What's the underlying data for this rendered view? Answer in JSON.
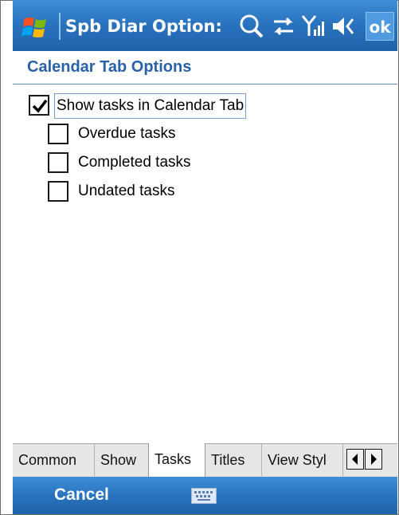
{
  "title_bar": {
    "title": "Spb Diar Option:",
    "ok_label": "ok",
    "icons": [
      "windows-start-icon",
      "search-icon",
      "connectivity-icon",
      "signal-icon",
      "volume-icon"
    ]
  },
  "page": {
    "title": "Calendar Tab Options"
  },
  "options": [
    {
      "label": "Show tasks in Calendar Tab",
      "checked": true
    },
    {
      "label": "Overdue tasks",
      "checked": false
    },
    {
      "label": "Completed tasks",
      "checked": false
    },
    {
      "label": "Undated tasks",
      "checked": false
    }
  ],
  "tabs": [
    {
      "label": "Common",
      "active": false
    },
    {
      "label": "Show",
      "active": false
    },
    {
      "label": "Tasks",
      "active": true
    },
    {
      "label": "Titles",
      "active": false
    },
    {
      "label": "View Styl",
      "active": false
    }
  ],
  "soft_keys": {
    "left": "Cancel",
    "center_icon": "keyboard-icon"
  },
  "colors": {
    "title_bar": "#2a73bf",
    "header_text": "#2a62a8",
    "tab_bar": "#e6e6e6"
  }
}
